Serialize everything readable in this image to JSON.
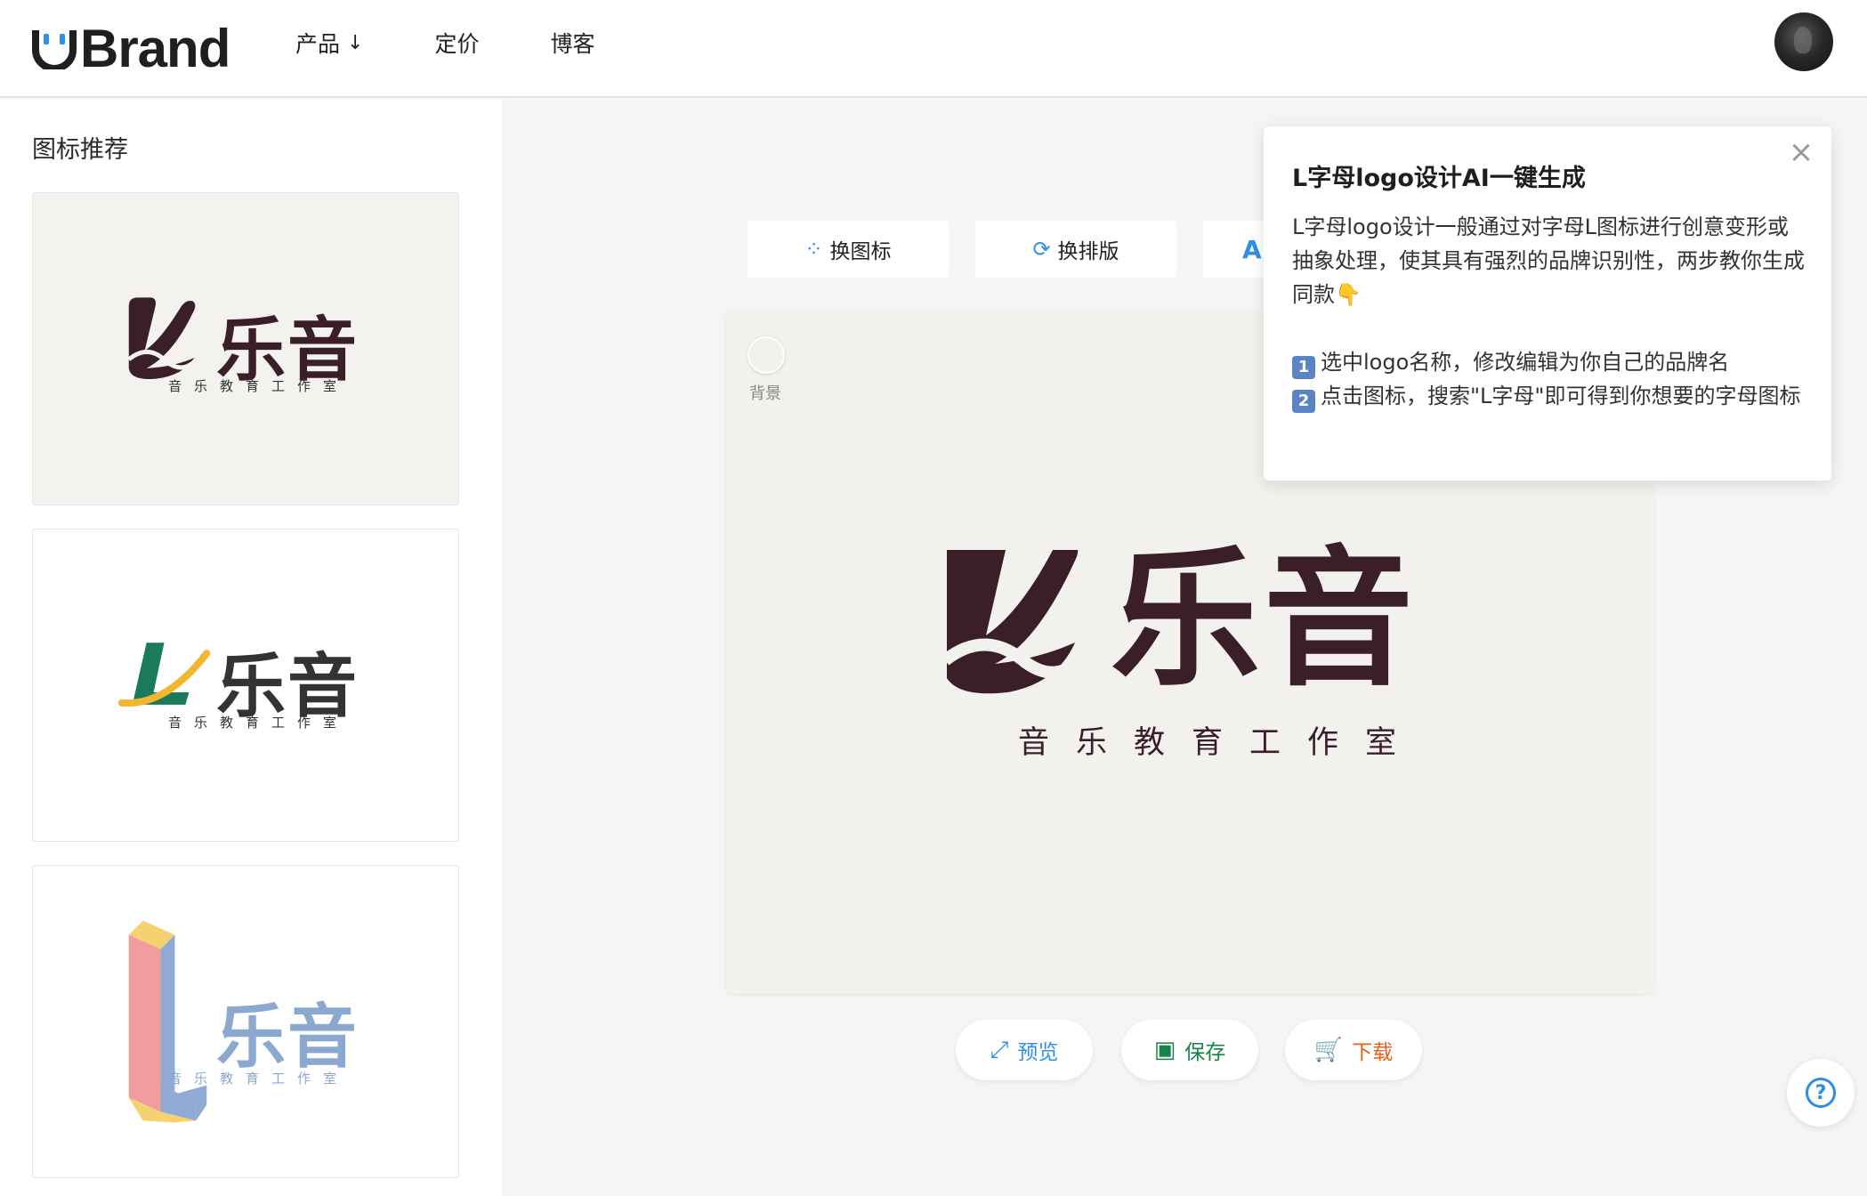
{
  "header": {
    "brand": "Brand",
    "nav": [
      {
        "label": "产品",
        "arrow": "↓"
      },
      {
        "label": "定价"
      },
      {
        "label": "博客"
      }
    ]
  },
  "sidebar": {
    "title": "图标推荐",
    "cards": [
      {
        "text": "乐音",
        "sub": "音乐教育工作室",
        "color": "#3a1f2b"
      },
      {
        "text": "乐音",
        "sub": "音乐教育工作室",
        "color": "#333333"
      },
      {
        "text": "乐音",
        "sub": "音乐教育工作室",
        "color": "#8aa8d0"
      }
    ]
  },
  "toolbar": {
    "change_icon": "换图标",
    "change_layout": "换排版",
    "font_glyph": "A"
  },
  "canvas": {
    "bg_label": "背景",
    "logo_text": "乐音",
    "logo_sub": "音乐教育工作室",
    "logo_color": "#3a1f2b"
  },
  "actions": {
    "preview": "预览",
    "save": "保存",
    "download": "下载"
  },
  "popover": {
    "title": "L字母logo设计AI一键生成",
    "intro": "L字母logo设计一般通过对字母L图标进行创意变形或抽象处理，使其具有强烈的品牌识别性，两步教你生成同款👇",
    "step1_num": "1",
    "step1": "选中logo名称，修改编辑为你自己的品牌名",
    "step2_num": "2",
    "step2": "点击图标，搜索\"L字母\"即可得到你想要的字母图标",
    "close": "×"
  },
  "help": {
    "glyph": "?"
  },
  "colors": {
    "accent": "#2f8ee8",
    "save": "#17834a",
    "download": "#e8601c",
    "logo": "#3a1f2b"
  }
}
